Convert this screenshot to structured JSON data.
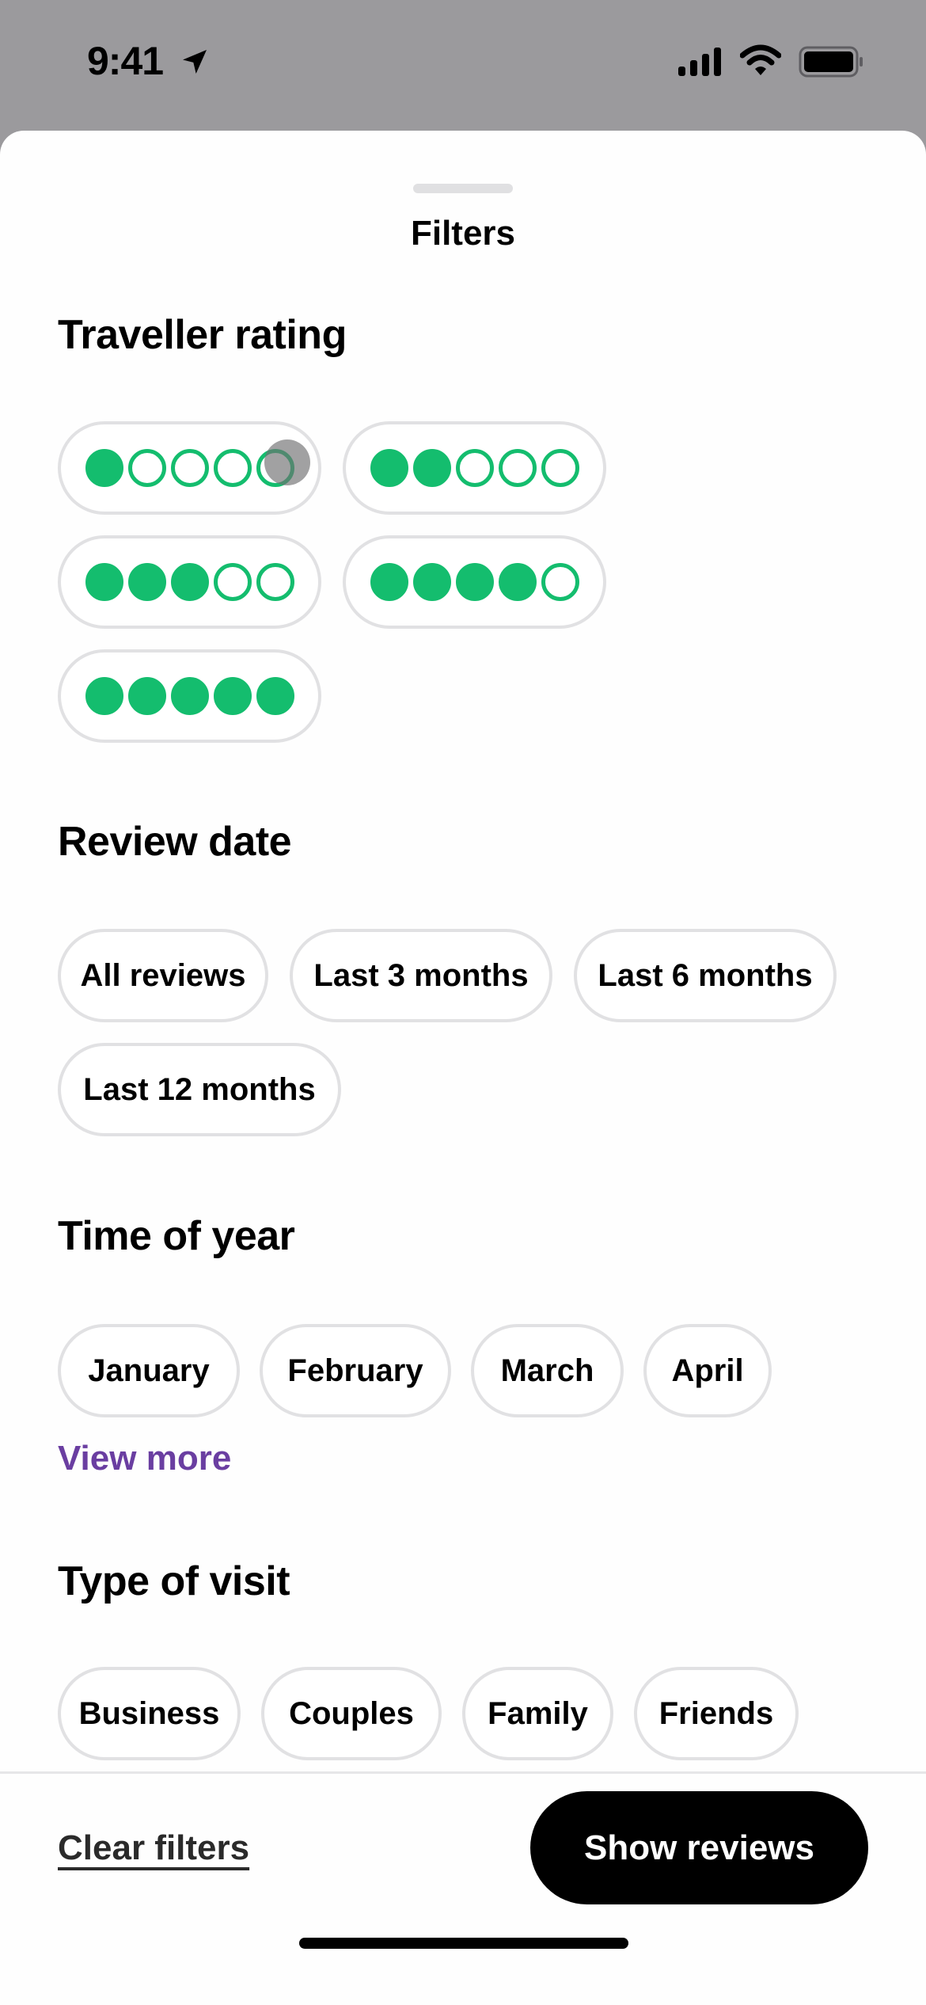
{
  "status_bar": {
    "time": "9:41",
    "icons": [
      "location-arrow-icon",
      "cellular-signal-icon",
      "wifi-icon",
      "battery-icon"
    ]
  },
  "sheet": {
    "title": "Filters"
  },
  "traveller_rating": {
    "title": "Traveller rating",
    "options": [
      {
        "rating": 1,
        "max": 5
      },
      {
        "rating": 2,
        "max": 5
      },
      {
        "rating": 3,
        "max": 5
      },
      {
        "rating": 4,
        "max": 5
      },
      {
        "rating": 5,
        "max": 5
      }
    ],
    "color": "#14bd6e"
  },
  "review_date": {
    "title": "Review date",
    "options": [
      "All reviews",
      "Last 3 months",
      "Last 6 months",
      "Last 12 months"
    ]
  },
  "time_of_year": {
    "title": "Time of year",
    "options": [
      "January",
      "February",
      "March",
      "April"
    ],
    "view_more": "View more",
    "link_color": "#6a3ea1"
  },
  "type_of_visit": {
    "title": "Type of visit",
    "options": [
      "Business",
      "Couples",
      "Family",
      "Friends"
    ]
  },
  "footer": {
    "clear_label": "Clear filters",
    "submit_label": "Show reviews"
  }
}
